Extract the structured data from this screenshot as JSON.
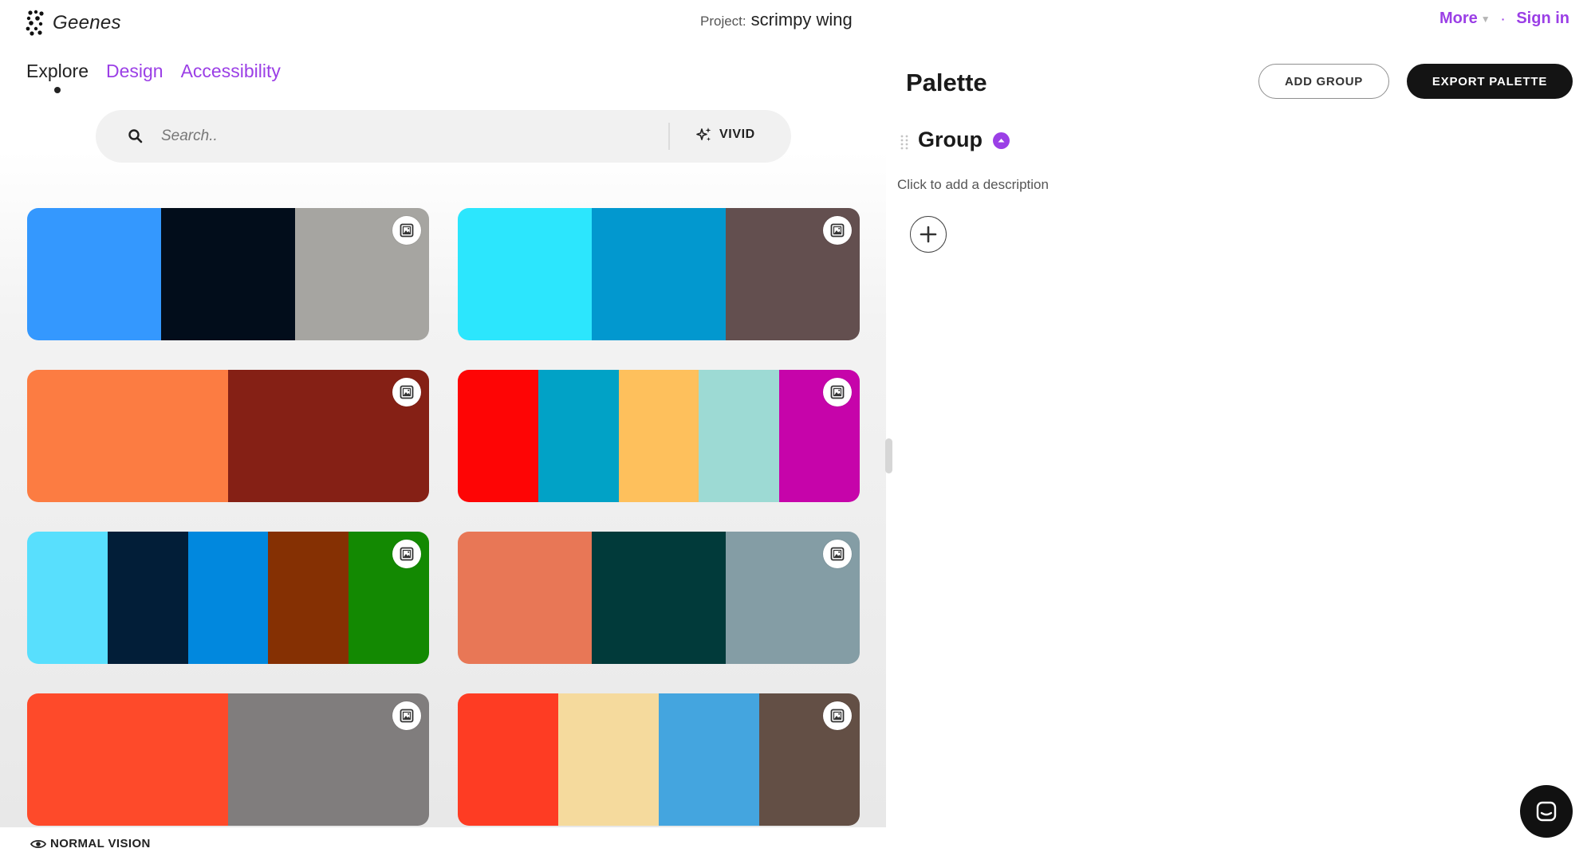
{
  "header": {
    "logo_text": "Geenes",
    "project_label": "Project:",
    "project_name": "scrimpy wing",
    "more_label": "More",
    "sign_in_label": "Sign in"
  },
  "tabs": [
    {
      "label": "Explore",
      "active": true
    },
    {
      "label": "Design",
      "active": false
    },
    {
      "label": "Accessibility",
      "active": false
    }
  ],
  "search": {
    "placeholder": "Search..",
    "value": "",
    "vivid_label": "VIVID"
  },
  "palettes": [
    {
      "colors": [
        "#3498fe",
        "#020d1b",
        "#a6a5a1"
      ]
    },
    {
      "colors": [
        "#2ce6fd",
        "#0298cf",
        "#634f4f"
      ]
    },
    {
      "colors": [
        "#fc7c42",
        "#852015"
      ]
    },
    {
      "colors": [
        "#fe0505",
        "#01a2c6",
        "#fec05c",
        "#9ddad4",
        "#c604aa"
      ]
    },
    {
      "colors": [
        "#58dffd",
        "#021e38",
        "#0188de",
        "#853003",
        "#138902"
      ]
    },
    {
      "colors": [
        "#e87756",
        "#013a3a",
        "#849da5"
      ]
    },
    {
      "colors": [
        "#fe4a2a",
        "#807d7d"
      ]
    },
    {
      "colors": [
        "#fe3c23",
        "#f5da9d",
        "#44a5df",
        "#634f45"
      ]
    }
  ],
  "vision_label": "NORMAL VISION",
  "palette_panel": {
    "title": "Palette",
    "add_group_label": "ADD GROUP",
    "export_label": "EXPORT PALETTE",
    "group_name": "Group",
    "group_description": "Click to add a description"
  },
  "colors": {
    "accent": "#9b3fe6",
    "dark_button": "#141414"
  }
}
